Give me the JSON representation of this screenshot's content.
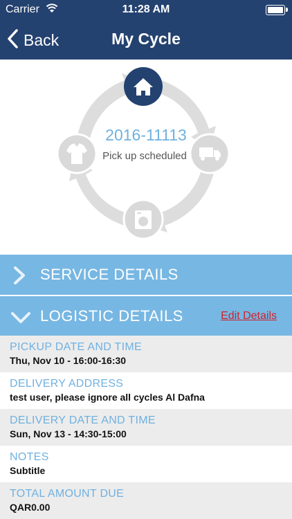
{
  "status_bar": {
    "carrier": "Carrier",
    "time": "11:28 AM"
  },
  "nav": {
    "back_label": "Back",
    "title": "My Cycle"
  },
  "cycle": {
    "order_number": "2016-11113",
    "status_text": "Pick up scheduled",
    "stage_icons": [
      "house-icon",
      "delivery-truck-icon",
      "washing-machine-icon",
      "shirt-icon"
    ],
    "active_stage": "house-icon"
  },
  "sections": {
    "service": {
      "label": "SERVICE DETAILS",
      "expanded": false
    },
    "logistic": {
      "label": "LOGISTIC DETAILS",
      "expanded": true,
      "edit_label": "Edit Details"
    }
  },
  "details": [
    {
      "label": "PICKUP DATE AND TIME",
      "value": "Thu, Nov 10 - 16:00-16:30"
    },
    {
      "label": "DELIVERY ADDRESS",
      "value": "test user, please ignore all cycles Al Dafna"
    },
    {
      "label": "DELIVERY DATE AND TIME",
      "value": "Sun, Nov 13 - 14:30-15:00"
    },
    {
      "label": "NOTES",
      "value": "Subtitle"
    },
    {
      "label": "TOTAL AMOUNT DUE",
      "value": "QAR0.00"
    }
  ],
  "colors": {
    "navy": "#244270",
    "section_blue": "#77b7e3",
    "label_blue": "#6fb1e0",
    "edit_red": "#d0212b",
    "ring_gray": "#dddddd"
  }
}
